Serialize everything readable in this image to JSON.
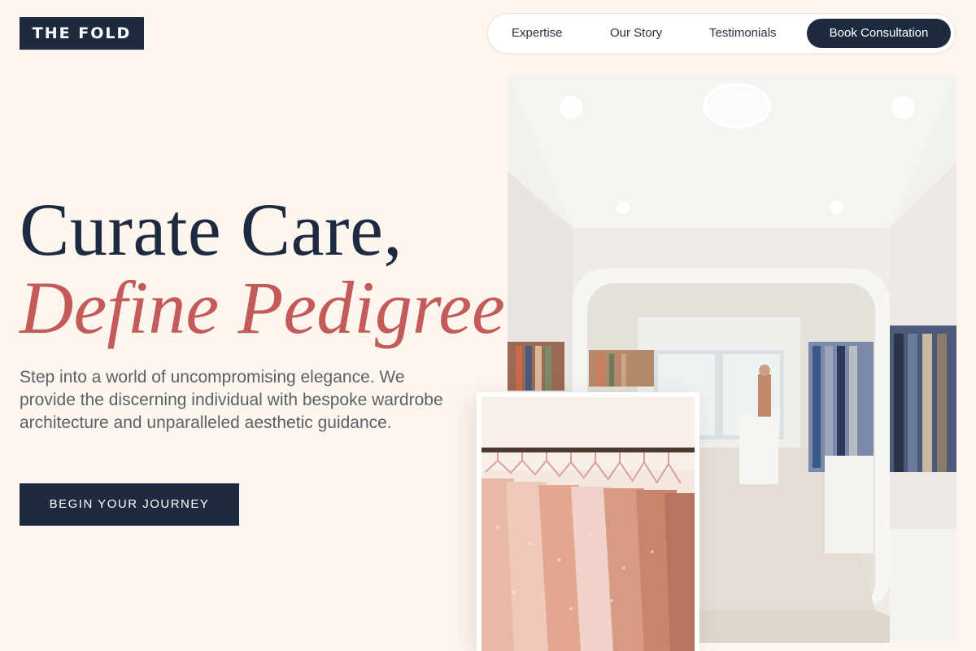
{
  "brand": {
    "logo_text": "THE FOLD"
  },
  "nav": {
    "links": [
      {
        "label": "Expertise"
      },
      {
        "label": "Our Story"
      },
      {
        "label": "Testimonials"
      }
    ],
    "cta_label": "Book Consultation"
  },
  "hero": {
    "headline_line1": "Curate Care,",
    "headline_line2": "Define Pedigree.",
    "description": "Step into a world of uncompromising elegance. We provide the discerning individual with bespoke wardrobe architecture and unparalleled aesthetic guidance.",
    "button_label": "BEGIN YOUR JOURNEY"
  },
  "colors": {
    "background": "#fdf6ee",
    "navy": "#1e2a3f",
    "accent_rose": "#c45b5b",
    "body_text": "#5b5f66"
  }
}
